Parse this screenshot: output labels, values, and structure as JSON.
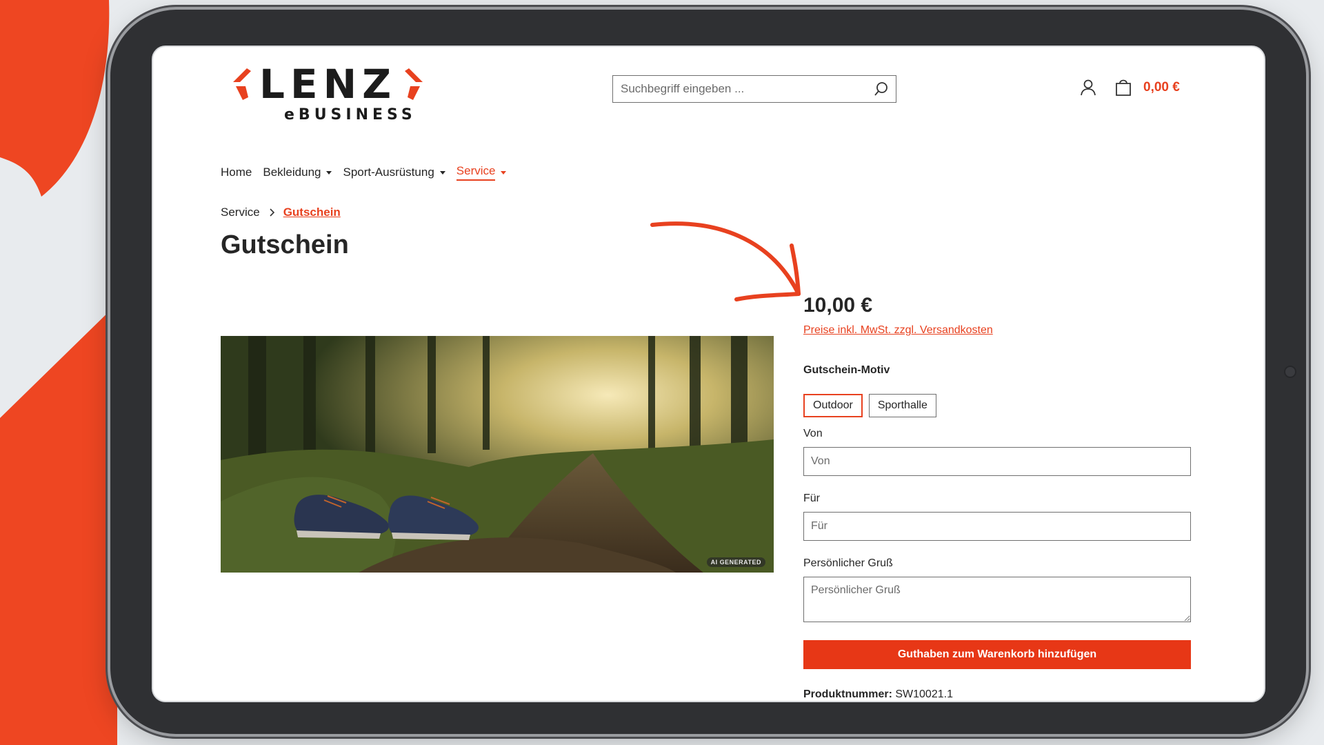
{
  "brand": {
    "name": "LENZ",
    "subtitle": "eBUSINESS",
    "accent_color": "#e8411f"
  },
  "header": {
    "search_placeholder": "Suchbegriff eingeben ...",
    "cart_total": "0,00 €"
  },
  "nav": {
    "items": [
      {
        "label": "Home",
        "dropdown": false
      },
      {
        "label": "Bekleidung",
        "dropdown": true
      },
      {
        "label": "Sport-Ausrüstung",
        "dropdown": true
      },
      {
        "label": "Service",
        "dropdown": true,
        "active": true
      }
    ]
  },
  "breadcrumb": {
    "parent": "Service",
    "current": "Gutschein"
  },
  "page": {
    "title": "Gutschein",
    "image_badge": "AI GENERATED"
  },
  "product": {
    "price": "10,00 €",
    "tax_note": "Preise inkl. MwSt. zzgl. Versandkosten",
    "motif_label": "Gutschein-Motiv",
    "motif_options": [
      "Outdoor",
      "Sporthalle"
    ],
    "motif_selected": "Outdoor",
    "from_label": "Von",
    "from_placeholder": "Von",
    "to_label": "Für",
    "to_placeholder": "Für",
    "message_label": "Persönlicher Gruß",
    "message_placeholder": "Persönlicher Gruß",
    "submit_label": "Guthaben zum Warenkorb hinzufügen",
    "sku_label": "Produktnummer:",
    "sku_value": "SW10021.1"
  }
}
